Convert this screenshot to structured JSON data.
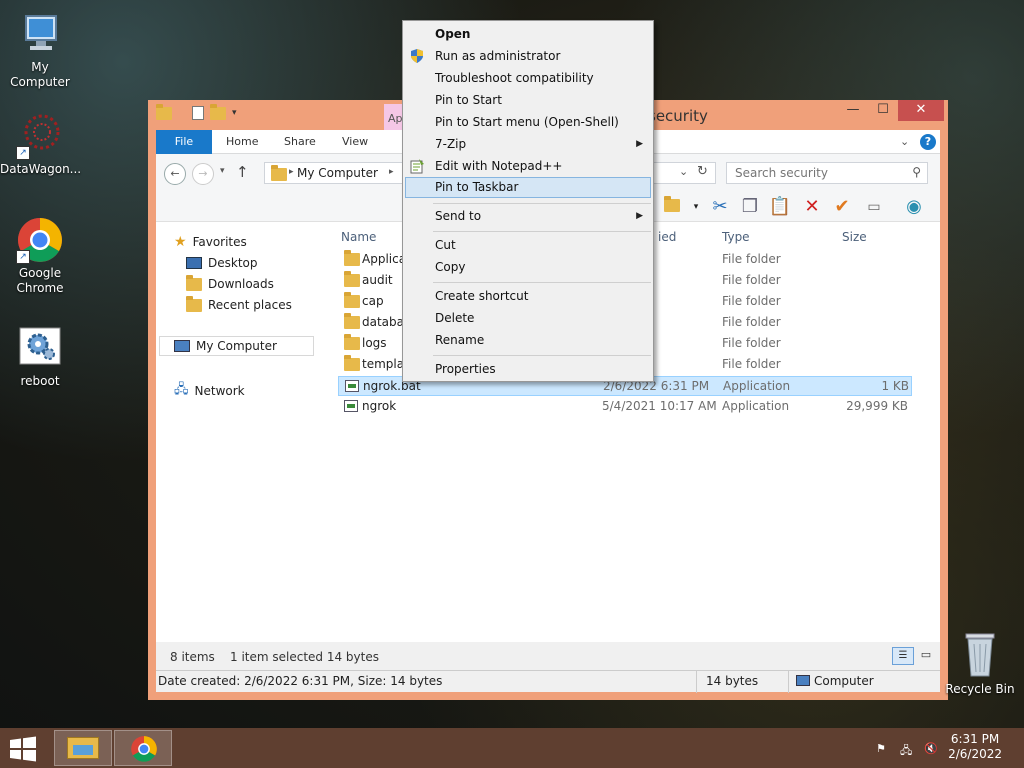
{
  "desktop": {
    "icons": [
      {
        "label": "My Computer"
      },
      {
        "label": "DataWagon..."
      },
      {
        "label": "Google\nChrome"
      },
      {
        "label": "reboot"
      }
    ],
    "recycle_bin": "Recycle Bin"
  },
  "explorer": {
    "title_fragment": "security",
    "context_tab_fragment": "Ap",
    "tabs": [
      "File",
      "Home",
      "Share",
      "View"
    ],
    "address_crumb": "My Computer",
    "search_placeholder": "Search security",
    "nav": {
      "favorites": "Favorites",
      "desktop": "Desktop",
      "downloads": "Downloads",
      "recent": "Recent places",
      "computer": "My Computer",
      "network": "Network"
    },
    "columns": {
      "name": "Name",
      "date_fragment": "ied",
      "type": "Type",
      "size": "Size"
    },
    "rows": [
      {
        "name": "Applicati",
        "date": "3:25 AM",
        "type": "File folder",
        "size": "",
        "kind": "folder"
      },
      {
        "name": "audit",
        "date": "1:36 AM",
        "type": "File folder",
        "size": "",
        "kind": "folder"
      },
      {
        "name": "cap",
        "date": "1:36 AM",
        "type": "File folder",
        "size": "",
        "kind": "folder"
      },
      {
        "name": "database",
        "date": "27 PM",
        "type": "File folder",
        "size": "",
        "kind": "folder"
      },
      {
        "name": "logs",
        "date": "1:36 AM",
        "type": "File folder",
        "size": "",
        "kind": "folder"
      },
      {
        "name": "template",
        "date": "03 AM",
        "type": "File folder",
        "size": "",
        "kind": "folder"
      },
      {
        "name": "ngrok.bat",
        "date": "2/6/2022 6:31 PM",
        "type": "Application",
        "size": "1 KB",
        "kind": "bat"
      },
      {
        "name": "ngrok",
        "date": "5/4/2021 10:17 AM",
        "type": "Application",
        "size": "29,999 KB",
        "kind": "exe"
      }
    ],
    "status": {
      "items": "8 items",
      "selected": "1 item selected  14 bytes"
    },
    "details": {
      "info": "Date created: 2/6/2022 6:31 PM, Size: 14 bytes",
      "size": "14 bytes",
      "location": "Computer"
    }
  },
  "context_menu": {
    "items": [
      {
        "label": "Open",
        "bold": true
      },
      {
        "label": "Run as administrator"
      },
      {
        "label": "Troubleshoot compatibility"
      },
      {
        "label": "Pin to Start"
      },
      {
        "label": "Pin to Start menu (Open-Shell)"
      },
      {
        "label": "7-Zip"
      },
      {
        "label": "Edit with Notepad++"
      },
      {
        "label": "Pin to Taskbar"
      },
      {
        "label": "Send to"
      },
      {
        "label": "Cut"
      },
      {
        "label": "Copy"
      },
      {
        "label": "Create shortcut"
      },
      {
        "label": "Delete"
      },
      {
        "label": "Rename"
      },
      {
        "label": "Properties"
      }
    ],
    "highlighted": "Pin to Taskbar"
  },
  "taskbar": {
    "time": "6:31 PM",
    "date": "2/6/2022"
  },
  "colors": {
    "window_frame": "#f0a07a",
    "close": "#c7504f",
    "file_tab": "#1979ca",
    "taskbar": "#5f3f30",
    "selection": "#cce8ff"
  }
}
